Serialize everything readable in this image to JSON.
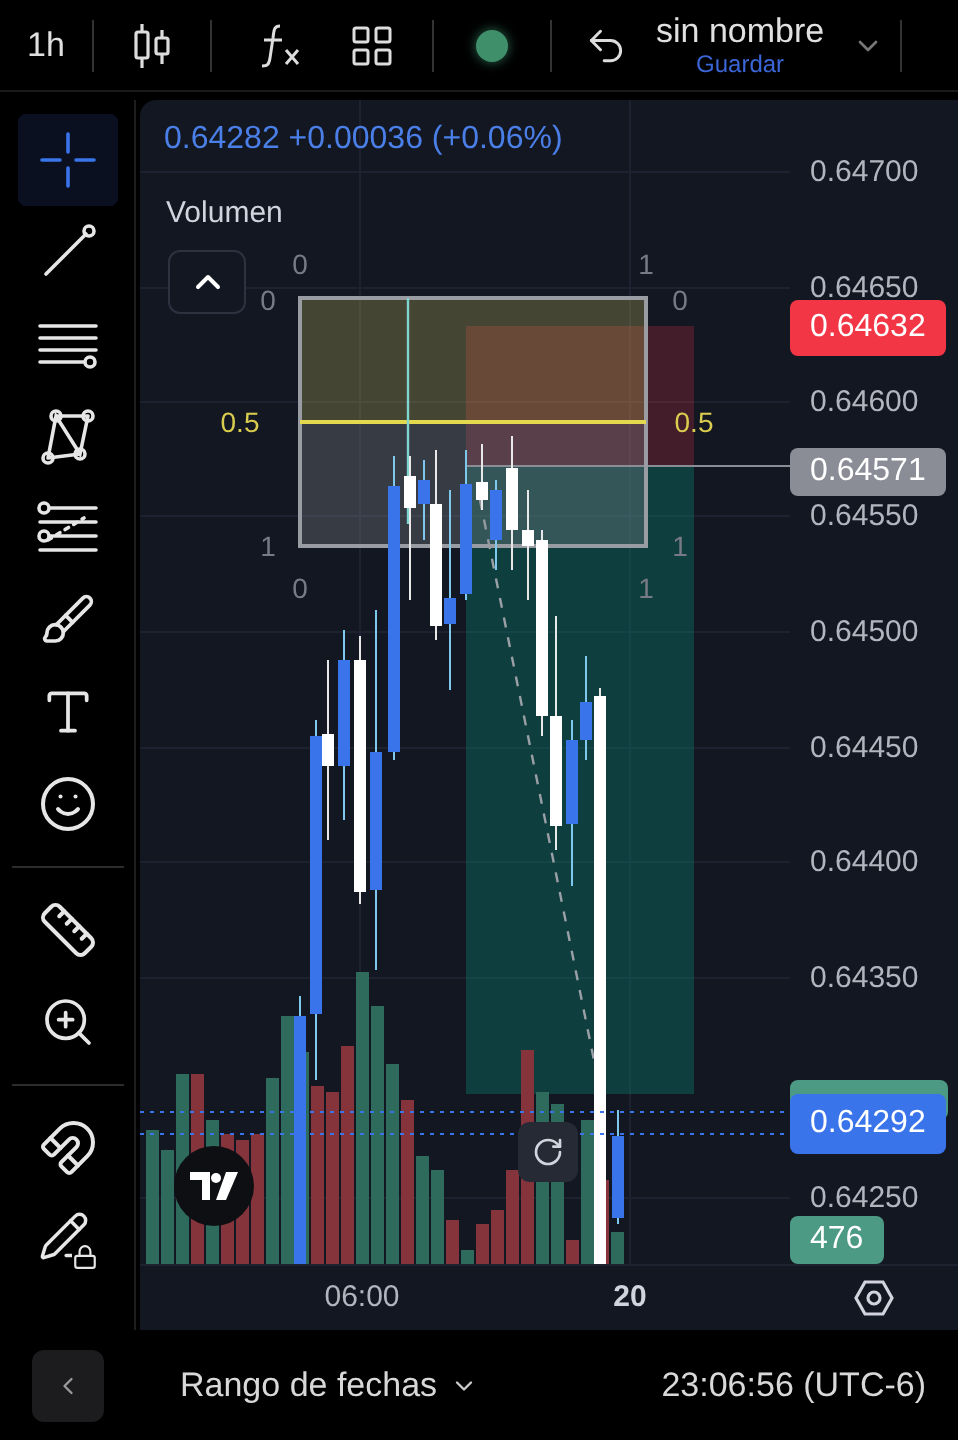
{
  "top_bar": {
    "interval": "1h",
    "title": "sin nombre",
    "save_label": "Guardar"
  },
  "drawing_tools": [
    {
      "kind": "crosshair",
      "selected": true
    },
    {
      "kind": "trend-line",
      "selected": false
    },
    {
      "kind": "horizontal-lines",
      "selected": false
    },
    {
      "kind": "pattern",
      "selected": false
    },
    {
      "kind": "fib",
      "selected": false
    },
    {
      "kind": "brush",
      "selected": false
    },
    {
      "kind": "text",
      "selected": false
    },
    {
      "kind": "emoji",
      "selected": false
    },
    {
      "kind": "divider"
    },
    {
      "kind": "ruler",
      "selected": false
    },
    {
      "kind": "zoom",
      "selected": false
    },
    {
      "kind": "divider"
    },
    {
      "kind": "magnet",
      "selected": false
    },
    {
      "kind": "lock-drawings",
      "selected": false
    }
  ],
  "legend": "0.64282 +0.00036 (+0.06%)",
  "volume_label": "Volumen",
  "fib_labels": [
    {
      "text": "0",
      "kind": "level"
    },
    {
      "text": "1",
      "kind": "level"
    },
    {
      "text": "0",
      "kind": "level"
    },
    {
      "text": "0",
      "kind": "level"
    },
    {
      "text": "0.5",
      "kind": "mid"
    },
    {
      "text": "0.5",
      "kind": "mid"
    },
    {
      "text": "1",
      "kind": "level"
    },
    {
      "text": "1",
      "kind": "level"
    },
    {
      "text": "0",
      "kind": "level"
    },
    {
      "text": "1",
      "kind": "level"
    }
  ],
  "price_axis": {
    "ticks": [
      "0.64700",
      "0.64650",
      "0.64600",
      "0.64550",
      "0.64500",
      "0.64450",
      "0.64400",
      "0.64350",
      "0.64250"
    ],
    "badges": [
      {
        "text": "0.64632",
        "color": "#f23645"
      },
      {
        "text": "0.64571",
        "color": "#8a8d96"
      },
      {
        "text": "0.64292",
        "color": "#3a74ea"
      },
      {
        "text": "476",
        "color": "#4c9a84"
      }
    ]
  },
  "time_axis": [
    {
      "text": "06:00",
      "kind": "time"
    },
    {
      "text": "20",
      "kind": "day"
    }
  ],
  "footer": {
    "range_label": "Rango de fechas",
    "clock": "23:06:56 (UTC-6)"
  }
}
